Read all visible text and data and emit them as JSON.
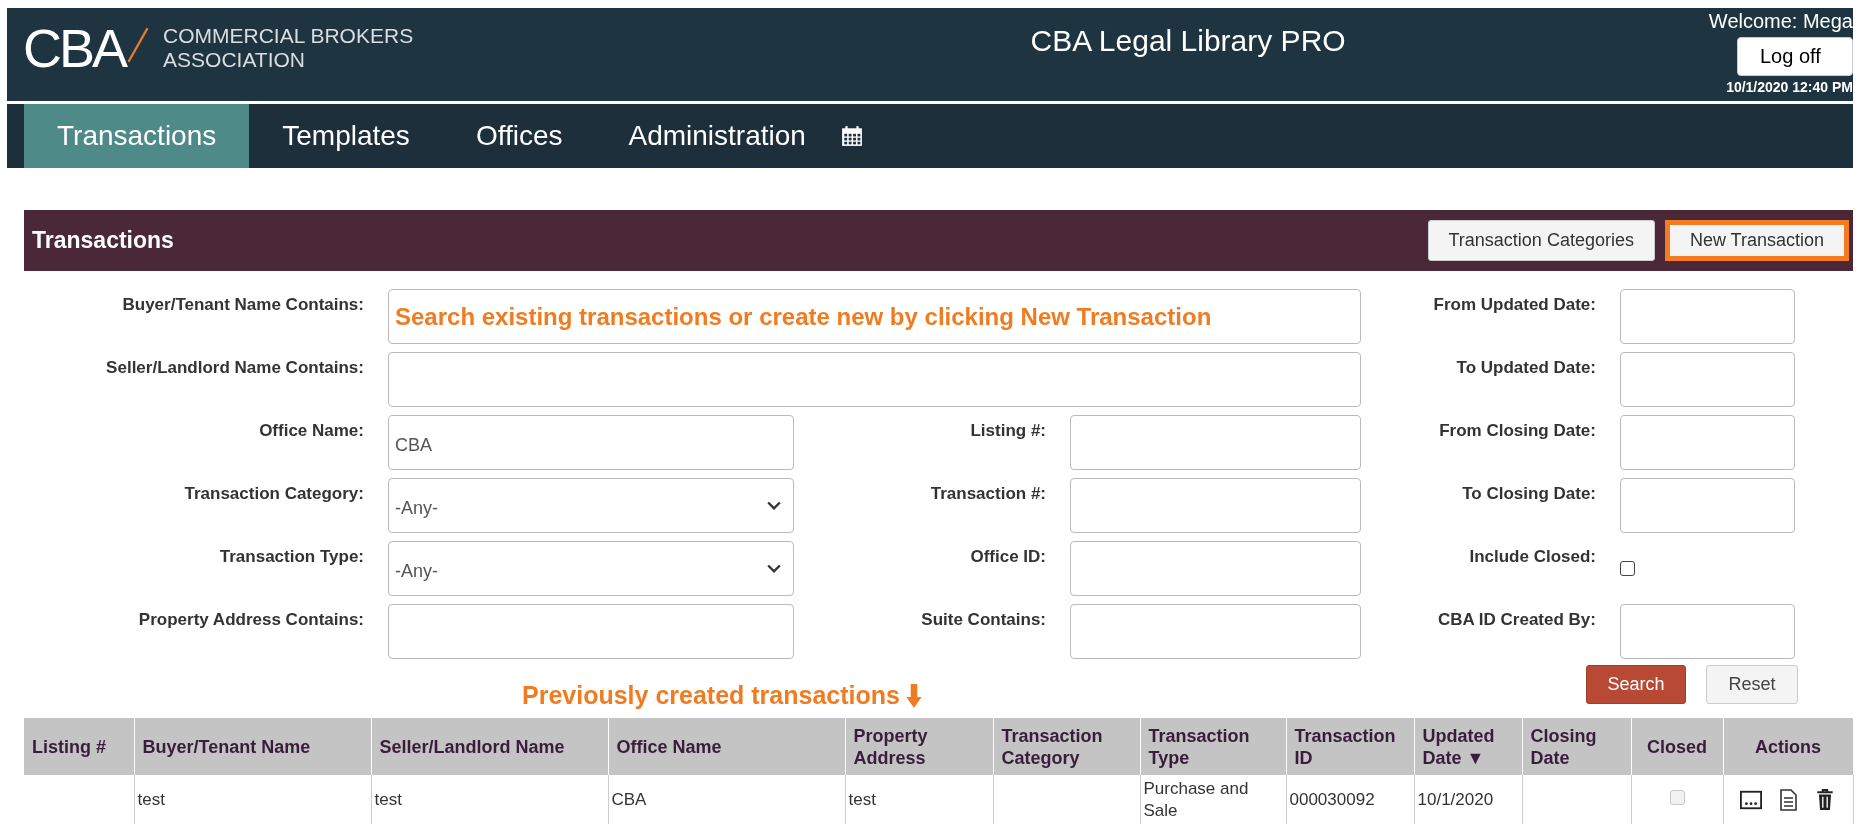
{
  "header": {
    "logo_main": "CBA",
    "logo_line1": "COMMERCIAL BROKERS",
    "logo_line2": "ASSOCIATION",
    "title": "CBA Legal Library PRO",
    "welcome": "Welcome: Mega",
    "logoff": "Log off",
    "datetime": "10/1/2020 12:40 PM"
  },
  "nav": [
    {
      "label": "Transactions",
      "selected": true
    },
    {
      "label": "Templates",
      "selected": false
    },
    {
      "label": "Offices",
      "selected": false
    },
    {
      "label": "Administration",
      "selected": false
    }
  ],
  "panel": {
    "title": "Transactions",
    "buttons": [
      {
        "label": "Transaction Categories",
        "highlighted": false
      },
      {
        "label": "New Transaction",
        "highlighted": true
      }
    ]
  },
  "form": {
    "left": [
      {
        "label": "Buyer/Tenant Name Contains:",
        "kind": "text",
        "value": "Search existing transactions or create new by clicking New Transaction",
        "annotation": true
      },
      {
        "label": "Seller/Landlord Name Contains:",
        "kind": "text"
      },
      {
        "label": "Office Name:",
        "kind": "text",
        "value": "CBA"
      },
      {
        "label": "Transaction Category:",
        "kind": "select",
        "value": "-Any-"
      },
      {
        "label": "Transaction Type:",
        "kind": "select",
        "value": "-Any-"
      },
      {
        "label": "Property Address Contains:",
        "kind": "text"
      }
    ],
    "middle": [
      {
        "label": "Listing #:",
        "kind": "text"
      },
      {
        "label": "Transaction #:",
        "kind": "text"
      },
      {
        "label": "Office ID:",
        "kind": "text"
      },
      {
        "label": "Suite Contains:",
        "kind": "text"
      }
    ],
    "right": [
      {
        "label": "From Updated Date:",
        "kind": "text"
      },
      {
        "label": "To Updated Date:",
        "kind": "text"
      },
      {
        "label": "From Closing Date:",
        "kind": "text"
      },
      {
        "label": "To Closing Date:",
        "kind": "text"
      },
      {
        "label": "Include Closed:",
        "kind": "checkbox",
        "checked": false
      },
      {
        "label": "CBA ID Created By:",
        "kind": "text"
      }
    ],
    "search": "Search",
    "reset": "Reset"
  },
  "annotation": "Previously created transactions",
  "table": {
    "columns": [
      "Listing #",
      "Buyer/Tenant Name",
      "Seller/Landlord Name",
      "Office Name",
      "Property Address",
      "Transaction Category",
      "Transaction Type",
      "Transaction ID",
      "Updated Date ▼",
      "Closing Date",
      "Closed",
      "Actions"
    ],
    "rows": [
      {
        "cells": [
          "",
          "test",
          "test",
          "CBA",
          "test",
          "",
          "Purchase and Sale",
          "000030092",
          "10/1/2020",
          ""
        ],
        "closed": {
          "checked": false,
          "disabled": true
        }
      }
    ]
  }
}
